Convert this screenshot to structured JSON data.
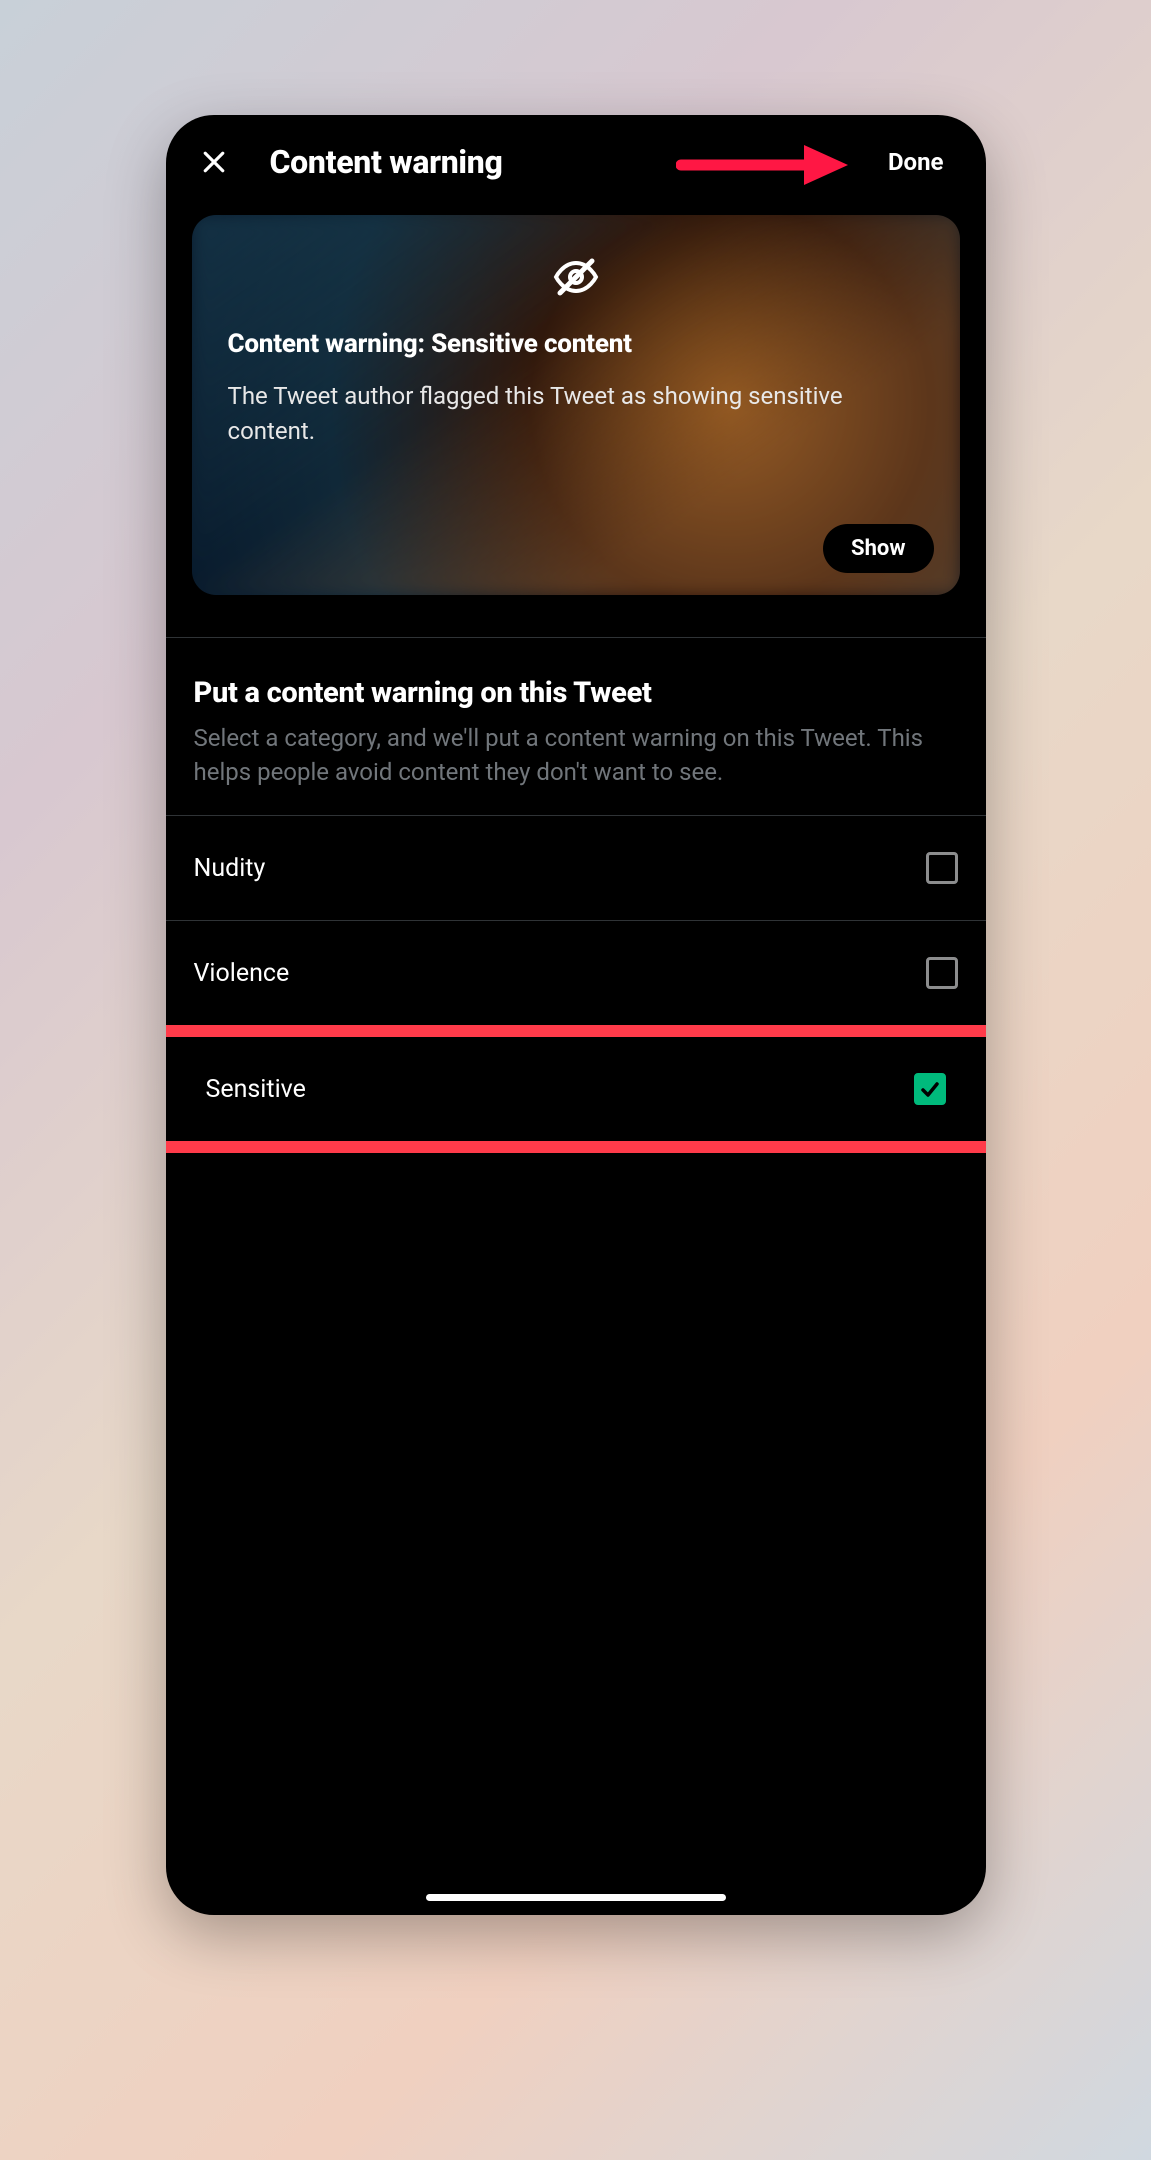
{
  "header": {
    "title": "Content warning",
    "done_label": "Done"
  },
  "preview": {
    "title": "Content warning: Sensitive content",
    "description": "The Tweet author flagged this Tweet as showing sensitive content.",
    "show_label": "Show"
  },
  "section": {
    "title": "Put a content warning on this Tweet",
    "description": "Select a category, and we'll put a content warning on this Tweet. This helps people avoid content they don't want to see."
  },
  "options": [
    {
      "label": "Nudity",
      "checked": false,
      "highlighted": false
    },
    {
      "label": "Violence",
      "checked": false,
      "highlighted": false
    },
    {
      "label": "Sensitive",
      "checked": true,
      "highlighted": true
    }
  ],
  "colors": {
    "accent_green": "#00ba7c",
    "annotation_red": "#ff3b4a"
  }
}
